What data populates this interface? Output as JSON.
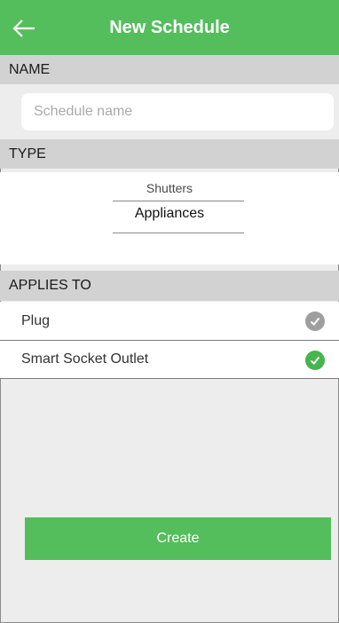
{
  "header": {
    "title": "New Schedule",
    "back_icon": "arrow-left-icon"
  },
  "name_section": {
    "label": "NAME",
    "input_value": "",
    "placeholder": "Schedule name"
  },
  "type_section": {
    "label": "TYPE",
    "options": [
      "Shutters",
      "Appliances"
    ],
    "selected": "Appliances"
  },
  "applies_to": {
    "label": "APPLIES TO",
    "items": [
      {
        "label": "Plug",
        "checked": false,
        "icon": "check-circle-icon"
      },
      {
        "label": "Smart Socket Outlet",
        "checked": true,
        "icon": "check-circle-icon"
      }
    ]
  },
  "actions": {
    "create_label": "Create"
  },
  "colors": {
    "accent": "#54bd5c",
    "section_bg": "#d2d2d2",
    "page_bg": "#ededed",
    "check_inactive": "#9e9e9e",
    "check_active": "#45b64f"
  }
}
